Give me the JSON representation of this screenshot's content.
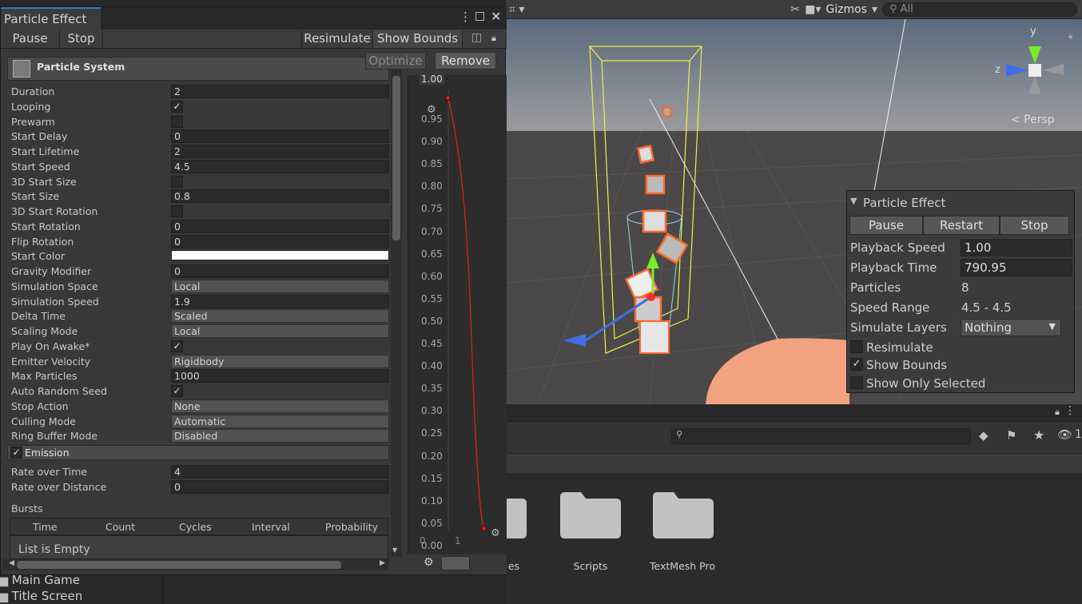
{
  "window": {
    "title": "Particle Effect",
    "pause_label": "Pause",
    "stop_label": "Stop",
    "resimulate_label": "Resimulate",
    "show_bounds_label": "Show Bounds"
  },
  "module": {
    "title": "Particle System",
    "optimize_label": "Optimize",
    "remove_label": "Remove"
  },
  "props": [
    {
      "label": "Duration",
      "type": "field",
      "value": "2"
    },
    {
      "label": "Looping",
      "type": "check",
      "checked": true
    },
    {
      "label": "Prewarm",
      "type": "check",
      "checked": false
    },
    {
      "label": "Start Delay",
      "type": "field",
      "value": "0"
    },
    {
      "label": "Start Lifetime",
      "type": "field",
      "value": "2"
    },
    {
      "label": "Start Speed",
      "type": "field",
      "value": "4.5"
    },
    {
      "label": "3D Start Size",
      "type": "check",
      "checked": false
    },
    {
      "label": "Start Size",
      "type": "field",
      "value": "0.8"
    },
    {
      "label": "3D Start Rotation",
      "type": "check",
      "checked": false
    },
    {
      "label": "Start Rotation",
      "type": "field",
      "value": "0"
    },
    {
      "label": "Flip Rotation",
      "type": "field",
      "value": "0"
    },
    {
      "label": "Start Color",
      "type": "color",
      "value": "#ffffff"
    },
    {
      "label": "Gravity Modifier",
      "type": "field",
      "value": "0"
    },
    {
      "label": "Simulation Space",
      "type": "dropdown",
      "value": "Local"
    },
    {
      "label": "Simulation Speed",
      "type": "field",
      "value": "1.9"
    },
    {
      "label": "Delta Time",
      "type": "dropdown",
      "value": "Scaled"
    },
    {
      "label": "Scaling Mode",
      "type": "dropdown",
      "value": "Local"
    },
    {
      "label": "Play On Awake*",
      "type": "check",
      "checked": true
    },
    {
      "label": "Emitter Velocity",
      "type": "dropdown",
      "value": "Rigidbody"
    },
    {
      "label": "Max Particles",
      "type": "field",
      "value": "1000"
    },
    {
      "label": "Auto Random Seed",
      "type": "check",
      "checked": true
    },
    {
      "label": "Stop Action",
      "type": "dropdown",
      "value": "None"
    },
    {
      "label": "Culling Mode",
      "type": "dropdown",
      "value": "Automatic"
    },
    {
      "label": "Ring Buffer Mode",
      "type": "dropdown",
      "value": "Disabled"
    }
  ],
  "emission": {
    "title": "Emission",
    "rate_over_time_label": "Rate over Time",
    "rate_over_time": "4",
    "rate_over_distance_label": "Rate over Distance",
    "rate_over_distance": "0",
    "bursts_label": "Bursts",
    "columns": [
      "Time",
      "Count",
      "Cycles",
      "Interval",
      "Probability"
    ],
    "empty_label": "List is Empty"
  },
  "curve": {
    "top_label": "1.00",
    "y_ticks": [
      "0.95",
      "0.90",
      "0.85",
      "0.80",
      "0.75",
      "0.70",
      "0.65",
      "0.60",
      "0.55",
      "0.50",
      "0.45",
      "0.40",
      "0.35",
      "0.30",
      "0.25",
      "0.20",
      "0.15",
      "0.10",
      "0.05",
      "0.00"
    ],
    "x_ticks": [
      "0",
      "1"
    ]
  },
  "scene": {
    "gizmos_label": "Gizmos",
    "search_placeholder": "All",
    "persp_label": "< Persp",
    "axis_y": "y",
    "axis_z": "z"
  },
  "overlay": {
    "title": "Particle Effect",
    "pause_label": "Pause",
    "restart_label": "Restart",
    "stop_label": "Stop",
    "playback_speed_label": "Playback Speed",
    "playback_speed": "1.00",
    "playback_time_label": "Playback Time",
    "playback_time": "790.95",
    "particles_label": "Particles",
    "particles": "8",
    "speed_range_label": "Speed Range",
    "speed_range": "4.5 - 4.5",
    "simulate_layers_label": "Simulate Layers",
    "simulate_layers": "Nothing",
    "resimulate_label": "Resimulate",
    "resimulate": false,
    "show_bounds_label": "Show Bounds",
    "show_bounds": true,
    "show_only_selected_label": "Show Only Selected",
    "show_only_selected": false
  },
  "project": {
    "folders": [
      {
        "name": "es"
      },
      {
        "name": "Scripts"
      },
      {
        "name": "TextMesh Pro"
      }
    ],
    "hidden_count": "1"
  },
  "hierarchy": [
    {
      "name": "Main Game"
    },
    {
      "name": "Title Screen"
    }
  ],
  "colors": {
    "accent": "#3a79bb",
    "curve": "#e02020",
    "bounds": "#f0f040",
    "particle_outline": "#ff6a2a"
  }
}
